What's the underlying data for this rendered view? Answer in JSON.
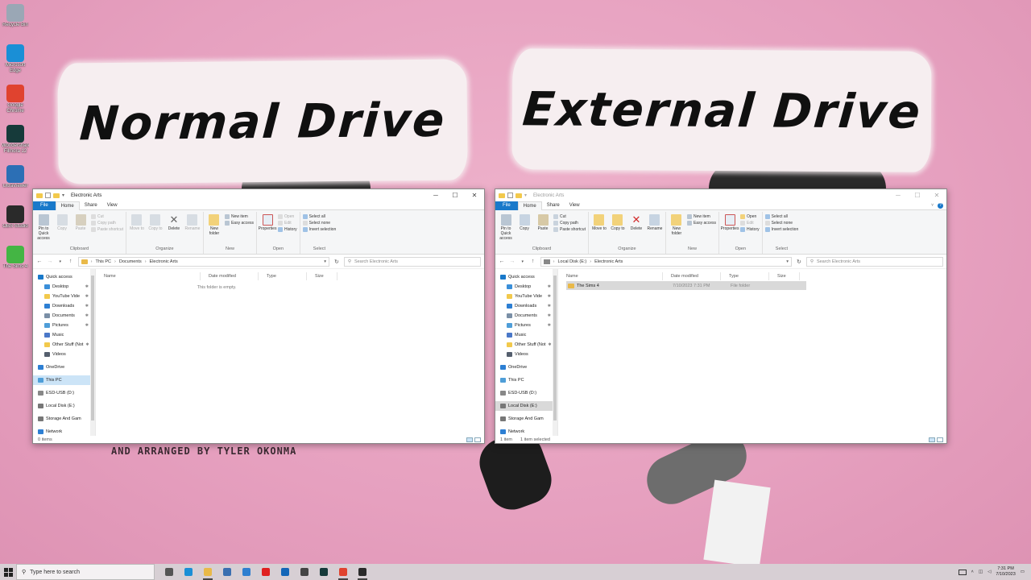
{
  "overlay": {
    "left_title": "Normal Drive",
    "right_title": "External Drive",
    "credits": "AND ARRANGED BY TYLER OKONMA"
  },
  "desktop_icons": [
    {
      "label": "Recycle Bin",
      "icon": "recycle-bin-icon",
      "color": "#9aa7b5"
    },
    {
      "label": "Microsoft Edge",
      "icon": "edge-icon",
      "color": "#1a8fd6"
    },
    {
      "label": "Google Chrome",
      "icon": "chrome-icon",
      "color": "#e0432f"
    },
    {
      "label": "Wondershare Filmora 12",
      "icon": "filmora-icon",
      "color": "#163a3a"
    },
    {
      "label": "UltraViewer",
      "icon": "ultraviewer-icon",
      "color": "#2c6fb5"
    },
    {
      "label": "OBS Studio",
      "icon": "obs-icon",
      "color": "#2a2a2a"
    },
    {
      "label": "The Sims 4",
      "icon": "sims-icon",
      "color": "#44b544"
    }
  ],
  "ribbon": {
    "tabs": [
      "File",
      "Home",
      "Share",
      "View"
    ],
    "pin": "Pin to Quick access",
    "copy": "Copy",
    "paste": "Paste",
    "cut": "Cut",
    "copy_path": "Copy path",
    "paste_shortcut": "Paste shortcut",
    "move_to": "Move to",
    "copy_to": "Copy to",
    "delete": "Delete",
    "rename": "Rename",
    "new_folder": "New folder",
    "new_item": "New item",
    "easy_access": "Easy access",
    "properties": "Properties",
    "open": "Open",
    "edit": "Edit",
    "history": "History",
    "select_all": "Select all",
    "select_none": "Select none",
    "invert_selection": "Invert selection",
    "groups": {
      "clipboard": "Clipboard",
      "organize": "Organize",
      "new": "New",
      "open": "Open",
      "select": "Select"
    }
  },
  "columns": {
    "name": "Name",
    "date": "Date modified",
    "type": "Type",
    "size": "Size"
  },
  "nav_items": {
    "quick_access": "Quick access",
    "desktop": "Desktop",
    "youtube": "YouTube Vide",
    "downloads": "Downloads",
    "documents": "Documents",
    "pictures": "Pictures",
    "music": "Music",
    "other": "Other Stuff (Not",
    "videos": "Videos",
    "onedrive": "OneDrive",
    "this_pc": "This PC",
    "esd": "ESD-USB (D:)",
    "local_disk": "Local Disk (E:)",
    "storage": "Storage And Gam",
    "network": "Network"
  },
  "left_window": {
    "title": "Electronic Arts",
    "breadcrumb": [
      "This PC",
      "Documents",
      "Electronic Arts"
    ],
    "search_placeholder": "Search Electronic Arts",
    "empty_message": "This folder is empty.",
    "status": "0 items"
  },
  "right_window": {
    "title": "Electronic Arts",
    "breadcrumb": [
      "Local Disk (E:)",
      "Electronic Arts"
    ],
    "search_placeholder": "Search Electronic Arts",
    "files": [
      {
        "name": "The Sims 4",
        "date": "7/10/2023 7:31 PM",
        "type": "File folder"
      }
    ],
    "status_count": "1 item",
    "status_selected": "1 item selected"
  },
  "taskbar": {
    "search_placeholder": "Type here to search",
    "time": "7:31 PM",
    "date": "7/10/2023",
    "apps": [
      {
        "name": "task-view-icon",
        "color": "#555555",
        "running": false
      },
      {
        "name": "edge-icon",
        "color": "#1a8fd6",
        "running": false
      },
      {
        "name": "file-explorer-icon",
        "color": "#e9b949",
        "running": true
      },
      {
        "name": "store-icon",
        "color": "#3a6fb0",
        "running": false
      },
      {
        "name": "mail-icon",
        "color": "#2f7fd0",
        "running": false
      },
      {
        "name": "youtube-icon",
        "color": "#e02020",
        "running": false
      },
      {
        "name": "outlook-icon",
        "color": "#1466b8",
        "running": false
      },
      {
        "name": "app-icon",
        "color": "#444444",
        "running": false
      },
      {
        "name": "filmora-icon",
        "color": "#163a3a",
        "running": false
      },
      {
        "name": "chrome-icon",
        "color": "#e0432f",
        "running": true
      },
      {
        "name": "obs-icon",
        "color": "#2a2a2a",
        "running": true
      }
    ]
  }
}
